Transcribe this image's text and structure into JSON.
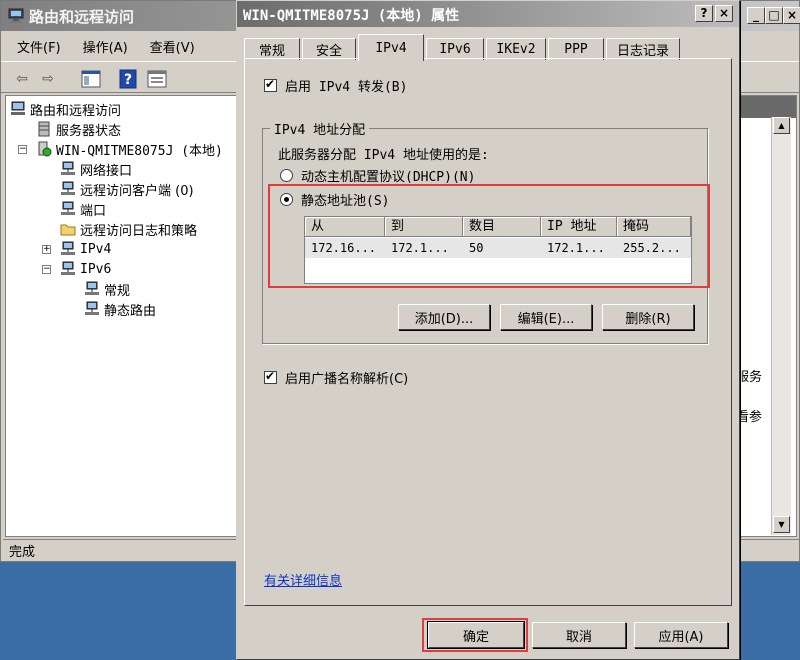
{
  "main_window": {
    "title": "路由和远程访问",
    "menus": [
      "文件(F)",
      "操作(A)",
      "查看(V)"
    ],
    "tree": [
      {
        "label": "路由和远程访问"
      },
      {
        "label": "服务器状态"
      },
      {
        "label": "WIN-QMITME8075J (本地)"
      },
      {
        "label": "网络接口"
      },
      {
        "label": "远程访问客户端 (0)"
      },
      {
        "label": "端口"
      },
      {
        "label": "远程访问日志和策略"
      },
      {
        "label": "IPv4"
      },
      {
        "label": "IPv6"
      },
      {
        "label": "常规"
      },
      {
        "label": "静态路由"
      }
    ],
    "right_pane_fragments": [
      "服务",
      "看参"
    ],
    "status": "完成"
  },
  "dialog": {
    "title": "WIN-QMITME8075J (本地) 属性",
    "tabs": [
      "常规",
      "安全",
      "IPv4",
      "IPv6",
      "IKEv2",
      "PPP",
      "日志记录"
    ],
    "active_tab": "IPv4",
    "enable_forwarding": "启用 IPv4 转发(B)",
    "group_title": "IPv4 地址分配",
    "group_desc": "此服务器分配 IPv4 地址使用的是:",
    "radio_dhcp": "动态主机配置协议(DHCP)(N)",
    "radio_static": "静态地址池(S)",
    "pool_table": {
      "headers": [
        "从",
        "到",
        "数目",
        "IP 地址",
        "掩码"
      ],
      "rows": [
        [
          "172.16...",
          "172.1...",
          "50",
          "172.1...",
          "255.2..."
        ]
      ]
    },
    "pool_buttons": {
      "add": "添加(D)...",
      "edit": "编辑(E)...",
      "delete": "删除(R)"
    },
    "enable_broadcast": "启用广播名称解析(C)",
    "help_link": "有关详细信息",
    "footer_buttons": {
      "ok": "确定",
      "cancel": "取消",
      "apply": "应用(A)"
    },
    "caption_help": "?",
    "caption_close": "×"
  },
  "colors": {
    "highlight": "#e03c3c",
    "link": "#0b35c9"
  }
}
